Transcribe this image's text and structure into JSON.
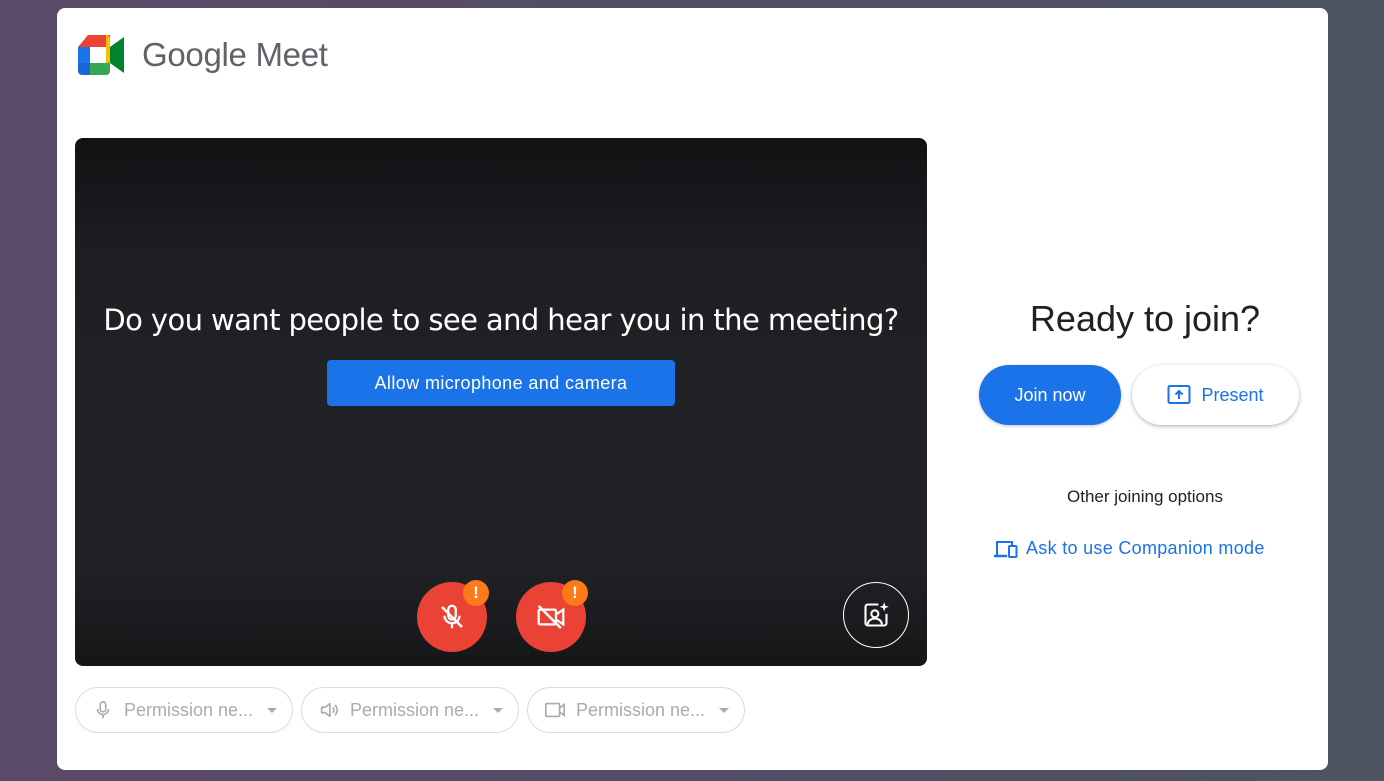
{
  "brand": {
    "name": "Google Meet",
    "logo_icon": "google-meet-logo"
  },
  "preview": {
    "question": "Do you want people to see and hear you in the meeting?",
    "allow_button_label": "Allow microphone and camera",
    "mic_button": {
      "icon": "mic-off-icon",
      "status": "warning"
    },
    "camera_button": {
      "icon": "camera-off-icon",
      "status": "warning"
    },
    "warning_glyph": "!",
    "effects_button_icon": "visual-effects-icon"
  },
  "devices": [
    {
      "icon": "microphone-icon",
      "label": "Permission ne..."
    },
    {
      "icon": "speaker-icon",
      "label": "Permission ne..."
    },
    {
      "icon": "video-camera-icon",
      "label": "Permission ne..."
    }
  ],
  "join_panel": {
    "title": "Ready to join?",
    "join_button_label": "Join now",
    "present_button_label": "Present",
    "other_options_label": "Other joining options",
    "companion_link_label": "Ask to use Companion mode"
  },
  "colors": {
    "accent": "#1a73e8",
    "danger": "#ea4335",
    "warning": "#fa7b17",
    "preview_bg": "#202124"
  }
}
